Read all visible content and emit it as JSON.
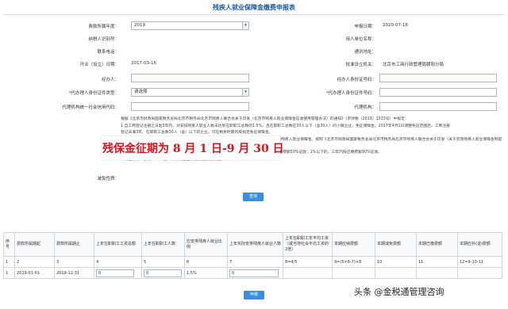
{
  "page": {
    "title": "残疾人就业保障金缴费申报表"
  },
  "form": {
    "fee_year_label": "费款所属年度：",
    "fee_year_value": "2019",
    "declare_date_label": "申报日期：",
    "declare_date_value": "2020-07-16",
    "taxpayer_id_label": "纳税人识别号：",
    "employer_name_label": "用人单位名称：",
    "phone_label": "联系电话：",
    "address_label": "通讯地址：",
    "open_date_label": "开业（设立）日期：",
    "open_date_value": "2017-03-16",
    "approving_org_label": "批准设立机关：",
    "approving_org_value": "北京市工商行政管理局朝阳分局",
    "handler_label": "经办人：",
    "handler_id_label": "经办人身份证号码：",
    "agent_id_type_label": "代办理人身份证件类型：",
    "agent_id_type_value": "请选择",
    "agent_id_no_label": "代办理人身份证件号码：",
    "agent_credit_code_label": "代理机构统一社会信用代码：",
    "agent_org_label": "代理机构：",
    "reduction_label": "减免性质：",
    "required_mark": "*"
  },
  "notice": {
    "lines": [
      "根据《北京市财政局国家税务总局北京市税务局北京市残疾人联合会关于印发〈北京市残疾人就业保障金征收使用管理办法〉的通知》（京财税〔2019〕1333号）中规定：",
      "1.自工商登记注册之日起3年内，对安排残疾人就业人数未达到在职职工总数的1.5%，且在职职工总数在30人以下（含30人）的小微企业，免征保障金。2017年4月1日调整免征范围后，工商注册",
      "登记未满3年、在职职工总数30人（含）以下的企业，可在剩余时期内按规定免征保障金。",
      "2.自2020年1月1日起至2022年12月31日，对在职职工总数30人（含）以下的企业，暂免征收残疾人就业保障金。按照《北京市财政局国家税务总局北京市税务局北京市残疾人联合会关于印发〈关于完善残疾人就业保障金制度更好促进残疾人就业的总体方案〉的通知》（京财税〔2019〕2015号）中",
      "1.用人单位安排残疾人就业比例1%（含）以上但低于本省（区、市）规定比例的，三年内按应缴费额50%征收；1%以下的，三年内按应缴费额90%征收。",
      "2.对在职职工总数30人（含）以下的企业，暂免征收保障金。"
    ],
    "banner": "残保金征期为 8 月 1 日-9 月 30 日"
  },
  "buttons": {
    "query": "查询",
    "submit": "申报"
  },
  "table": {
    "headers": [
      "序号",
      "费款所属期起",
      "费款所属期止",
      "上年在职职工工资总额",
      "上年在职职工人数",
      "应安排残疾人就业比例",
      "上年实际安排残疾人就业人数",
      "上年在职职工年平均工资（或当地社会平均工资的2倍）",
      "本期应纳费额",
      "本期减免费额",
      "本期已缴费额",
      "本期应补(退)费额"
    ],
    "rows": [
      [
        "1",
        "2",
        "3",
        "4",
        "5",
        "6",
        "7",
        "8=4/5",
        "9=(5×6-7)×8",
        "10",
        "11",
        "12=9-10-11"
      ],
      [
        "1",
        "2019-01-01",
        "2019-12-31",
        "0",
        "0",
        "1.5%",
        "0",
        "",
        "",
        "",
        "",
        ""
      ]
    ]
  },
  "watermark": "头条 @金税通管理咨询",
  "colors": {
    "accent": "#3c8fe0",
    "title": "#1a5aa6",
    "banner_text": "#d9131b"
  }
}
